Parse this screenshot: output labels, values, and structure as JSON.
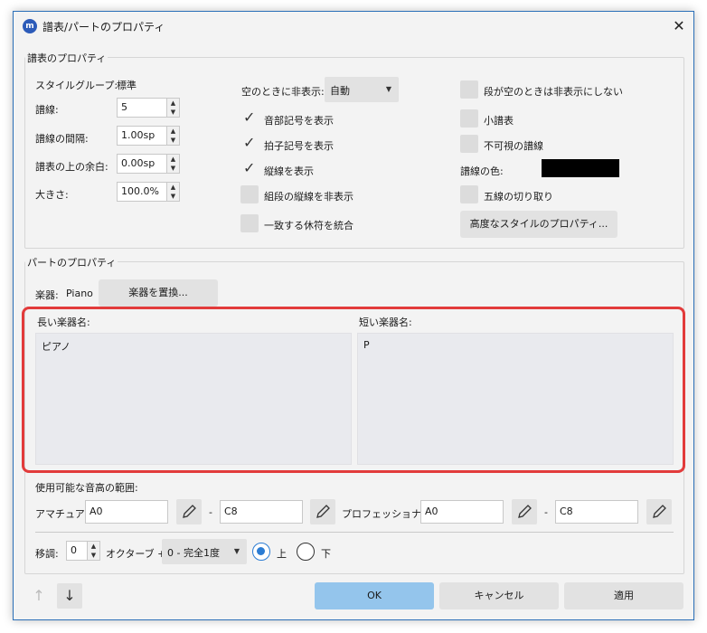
{
  "window": {
    "title": "譜表/パートのプロパティ",
    "app_icon_text": "m"
  },
  "staff_props": {
    "group_title": "譜表のプロパティ",
    "style_group_label": "スタイルグループ:",
    "style_group_value": "標準",
    "lines_label": "譜線:",
    "lines_value": "5",
    "line_distance_label": "譜線の間隔:",
    "line_distance_value": "1.00sp",
    "extra_distance_label": "譜表の上の余白:",
    "extra_distance_value": "0.00sp",
    "scale_label": "大きさ:",
    "scale_value": "100.0%",
    "hide_when_empty_label": "空のときに非表示:",
    "hide_when_empty_value": "自動",
    "show_clef": "音部記号を表示",
    "show_timesig": "拍子記号を表示",
    "show_barlines": "縦線を表示",
    "hide_system_barline": "組段の縦線を非表示",
    "merge_rests": "一致する休符を統合",
    "dont_hide_empty": "段が空のときは非表示にしない",
    "small_staff": "小譜表",
    "invisible_lines": "不可視の譜線",
    "line_color_label": "譜線の色:",
    "line_color": "#000000",
    "cutaway": "五線の切り取り",
    "advanced_button": "高度なスタイルのプロパティ..."
  },
  "part_props": {
    "group_title": "パートのプロパティ",
    "instrument_label": "楽器:",
    "instrument_value": "Piano",
    "change_instrument_button": "楽器を置換...",
    "long_name_label": "長い楽器名:",
    "long_name_value": "ピアノ",
    "short_name_label": "短い楽器名:",
    "short_name_value": "P",
    "range_label": "使用可能な音高の範囲:",
    "amateur_label": "アマチュア:",
    "amateur_low": "A0",
    "amateur_high": "C8",
    "dash": "-",
    "professional_label": "プロフェッショナル:",
    "pro_low": "A0",
    "pro_high": "C8",
    "transpose_label": "移調:",
    "octave_value": "0",
    "octave_label": "オクターブ +",
    "interval_value": "0 - 完全1度",
    "up_label": "上",
    "down_label": "下"
  },
  "footer": {
    "ok": "OK",
    "cancel": "キャンセル",
    "apply": "適用",
    "up_arrow": "↑",
    "down_arrow": "↓"
  },
  "colors": {
    "highlight": "#e23b3b",
    "primary_button": "#94c5ec"
  }
}
